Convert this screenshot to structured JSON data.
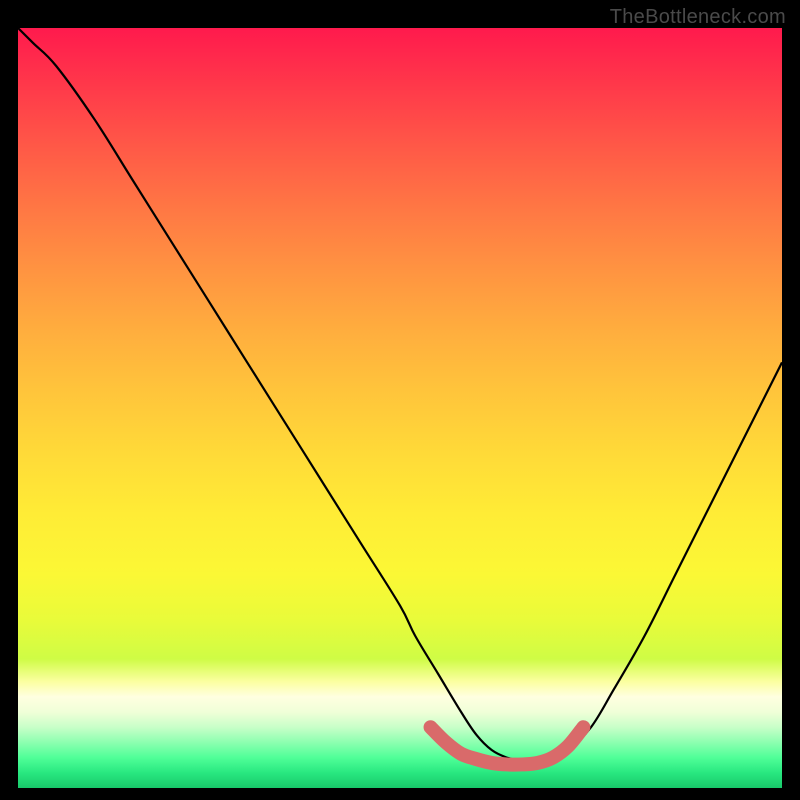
{
  "watermark": "TheBottleneck.com",
  "chart_data": {
    "type": "line",
    "title": "",
    "xlabel": "",
    "ylabel": "",
    "xlim": [
      0,
      100
    ],
    "ylim": [
      0,
      100
    ],
    "series": [
      {
        "name": "bottleneck-curve",
        "x": [
          0,
          2,
          5,
          10,
          15,
          20,
          25,
          30,
          35,
          40,
          45,
          50,
          52,
          55,
          58,
          60,
          62,
          64,
          66,
          68,
          70,
          72,
          75,
          78,
          82,
          86,
          90,
          95,
          100
        ],
        "y": [
          100,
          98,
          95,
          88,
          80,
          72,
          64,
          56,
          48,
          40,
          32,
          24,
          20,
          15,
          10,
          7,
          5,
          4,
          3.5,
          3.5,
          4,
          5,
          8,
          13,
          20,
          28,
          36,
          46,
          56
        ],
        "color": "#000000"
      },
      {
        "name": "highlight-curve",
        "x": [
          54,
          56,
          58,
          60,
          62,
          64,
          66,
          68,
          70,
          72,
          74
        ],
        "y": [
          8,
          6,
          4.5,
          3.8,
          3.3,
          3.1,
          3.1,
          3.3,
          4,
          5.5,
          8
        ],
        "color": "#d96a6a"
      }
    ],
    "colors": {
      "gradient_top": "#ff1a4d",
      "gradient_mid": "#ffe436",
      "gradient_bottom": "#18c86a",
      "highlight": "#d96a6a",
      "curve": "#000000",
      "frame": "#000000"
    }
  }
}
